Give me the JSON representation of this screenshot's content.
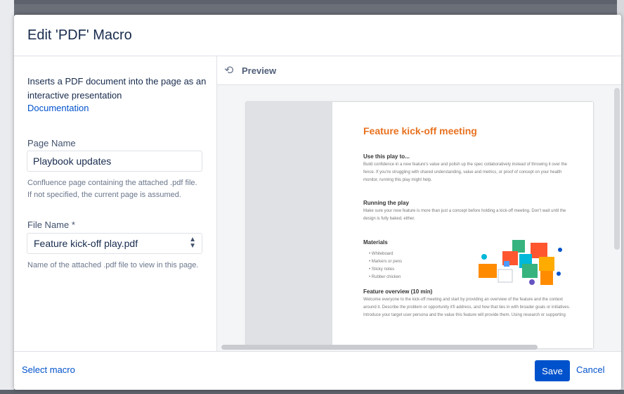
{
  "dialog": {
    "title": "Edit 'PDF' Macro"
  },
  "form": {
    "description": "Inserts a PDF document into the page as an interactive presentation",
    "documentation_link": "Documentation",
    "page_name": {
      "label": "Page Name",
      "value": "Playbook updates",
      "help": "Confluence page containing the attached .pdf file. If not specified, the current page is assumed."
    },
    "file_name": {
      "label": "File Name *",
      "selected": "Feature kick-off play.pdf",
      "help": "Name of the attached .pdf file to view in this page."
    }
  },
  "preview": {
    "icon": "refresh-icon",
    "label": "Preview",
    "pdf": {
      "title": "Feature kick-off meeting",
      "sections": [
        {
          "heading": "Use this play to...",
          "text": "Build confidence in a new feature's value and polish up the spec collaboratively instead of throwing it over the fence. If you're struggling with shared understanding, value and metrics, or proof of concept on your health monitor, running this play might help."
        },
        {
          "heading": "Running the play",
          "text": "Make sure your new feature is more than just a concept before holding a kick-off meeting. Don't wait until the design is fully baked, either."
        },
        {
          "heading": "Materials",
          "bullets": [
            "Whiteboard",
            "Markers or pens",
            "Sticky notes",
            "Rubber chicken"
          ]
        },
        {
          "heading": "Feature overview (10 min)",
          "text": "Welcome everyone to the kick-off meeting and start by providing an overview of the feature and the context around it. Describe the problem or opportunity it'll address, and how that ties in with broader goals or initiatives. Introduce your target user persona and the value this feature will provide them. Using research or supporting"
        }
      ]
    }
  },
  "footer": {
    "select_macro": "Select macro",
    "save": "Save",
    "cancel": "Cancel"
  },
  "colors": {
    "primary": "#0052cc",
    "accent": "#e8711f",
    "overlay": "#6b6f78"
  }
}
